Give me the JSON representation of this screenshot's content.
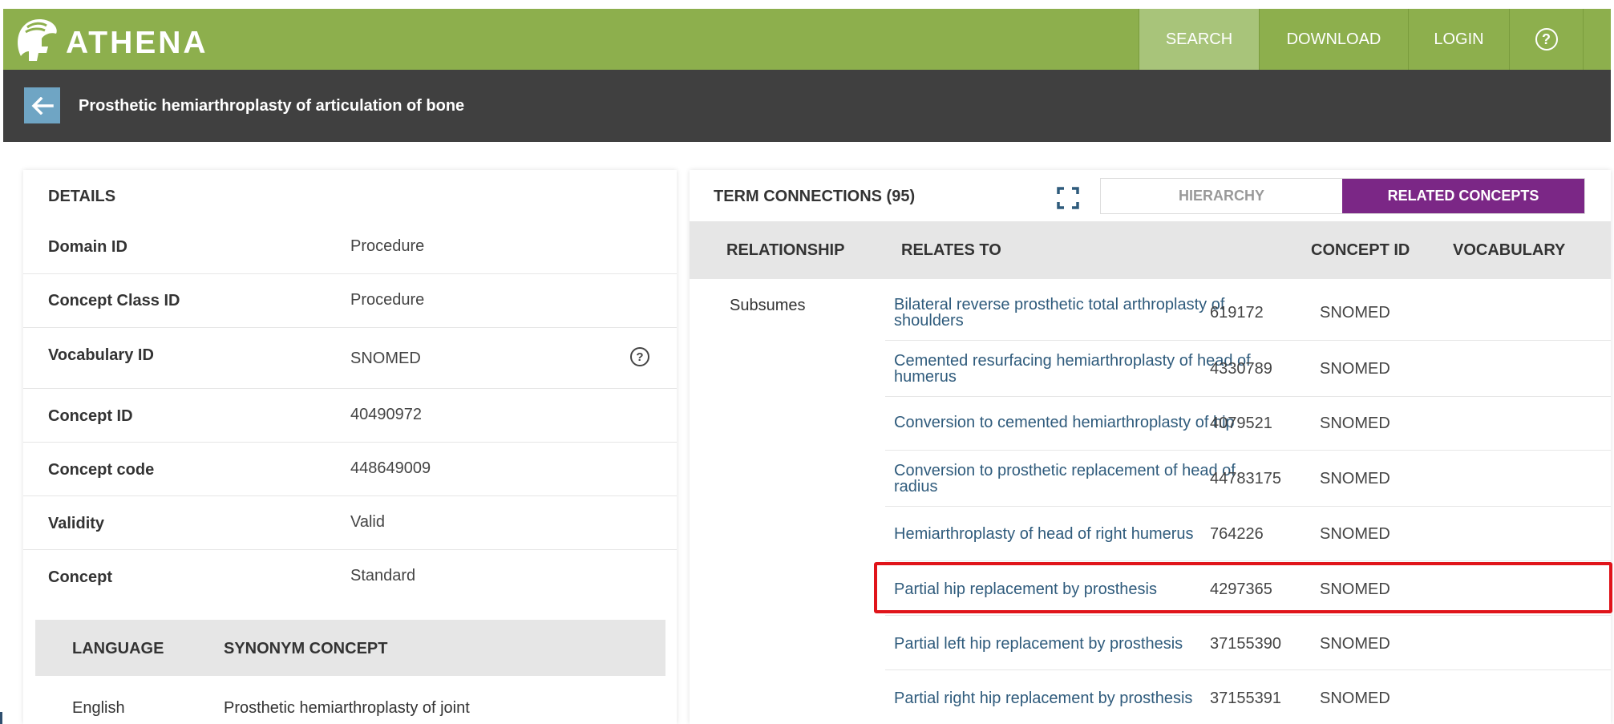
{
  "app": {
    "name": "ATHENA"
  },
  "nav": {
    "search": "SEARCH",
    "download": "DOWNLOAD",
    "login": "LOGIN",
    "help": "?"
  },
  "title_bar": {
    "title": "Prosthetic hemiarthroplasty of articulation of bone"
  },
  "details": {
    "title": "DETAILS",
    "rows": [
      {
        "label": "Domain ID",
        "value": "Procedure"
      },
      {
        "label": "Concept Class ID",
        "value": "Procedure"
      },
      {
        "label": "Vocabulary ID",
        "value": "SNOMED"
      },
      {
        "label": "Concept ID",
        "value": "40490972"
      },
      {
        "label": "Concept code",
        "value": "448649009"
      },
      {
        "label": "Validity",
        "value": "Valid"
      },
      {
        "label": "Concept",
        "value": "Standard"
      }
    ],
    "synonyms": {
      "headers": [
        "LANGUAGE",
        "SYNONYM CONCEPT"
      ],
      "rows": [
        {
          "language": "English",
          "concept": "Prosthetic hemiarthroplasty of joint"
        }
      ]
    }
  },
  "terms": {
    "title": "TERM CONNECTIONS (95)",
    "tabs": [
      "HIERARCHY",
      "RELATED CONCEPTS"
    ],
    "active_tab": "RELATED CONCEPTS",
    "headers": [
      "RELATIONSHIP",
      "RELATES TO",
      "CONCEPT ID",
      "VOCABULARY"
    ],
    "relationship": "Subsumes",
    "rows": [
      {
        "name": "Bilateral reverse prosthetic total arthroplasty of shoulders",
        "id": "619172",
        "vocab": "SNOMED"
      },
      {
        "name": "Cemented resurfacing hemiarthroplasty of head of humerus",
        "id": "4330789",
        "vocab": "SNOMED"
      },
      {
        "name": "Conversion to cemented hemiarthroplasty of hip",
        "id": "4079521",
        "vocab": "SNOMED"
      },
      {
        "name": "Conversion to prosthetic replacement of head of radius",
        "id": "44783175",
        "vocab": "SNOMED"
      },
      {
        "name": "Hemiarthroplasty of head of right humerus",
        "id": "764226",
        "vocab": "SNOMED"
      },
      {
        "name": "Partial hip replacement by prosthesis",
        "id": "4297365",
        "vocab": "SNOMED"
      },
      {
        "name": "Partial left hip replacement by prosthesis",
        "id": "37155390",
        "vocab": "SNOMED"
      },
      {
        "name": "Partial right hip replacement by prosthesis",
        "id": "37155391",
        "vocab": "SNOMED"
      }
    ]
  },
  "colors": {
    "topbar": "#8daf4d",
    "titlebar": "#404040",
    "active_tab": "#7b2786",
    "link": "#2f5b7c",
    "highlight": "#e0141a"
  }
}
